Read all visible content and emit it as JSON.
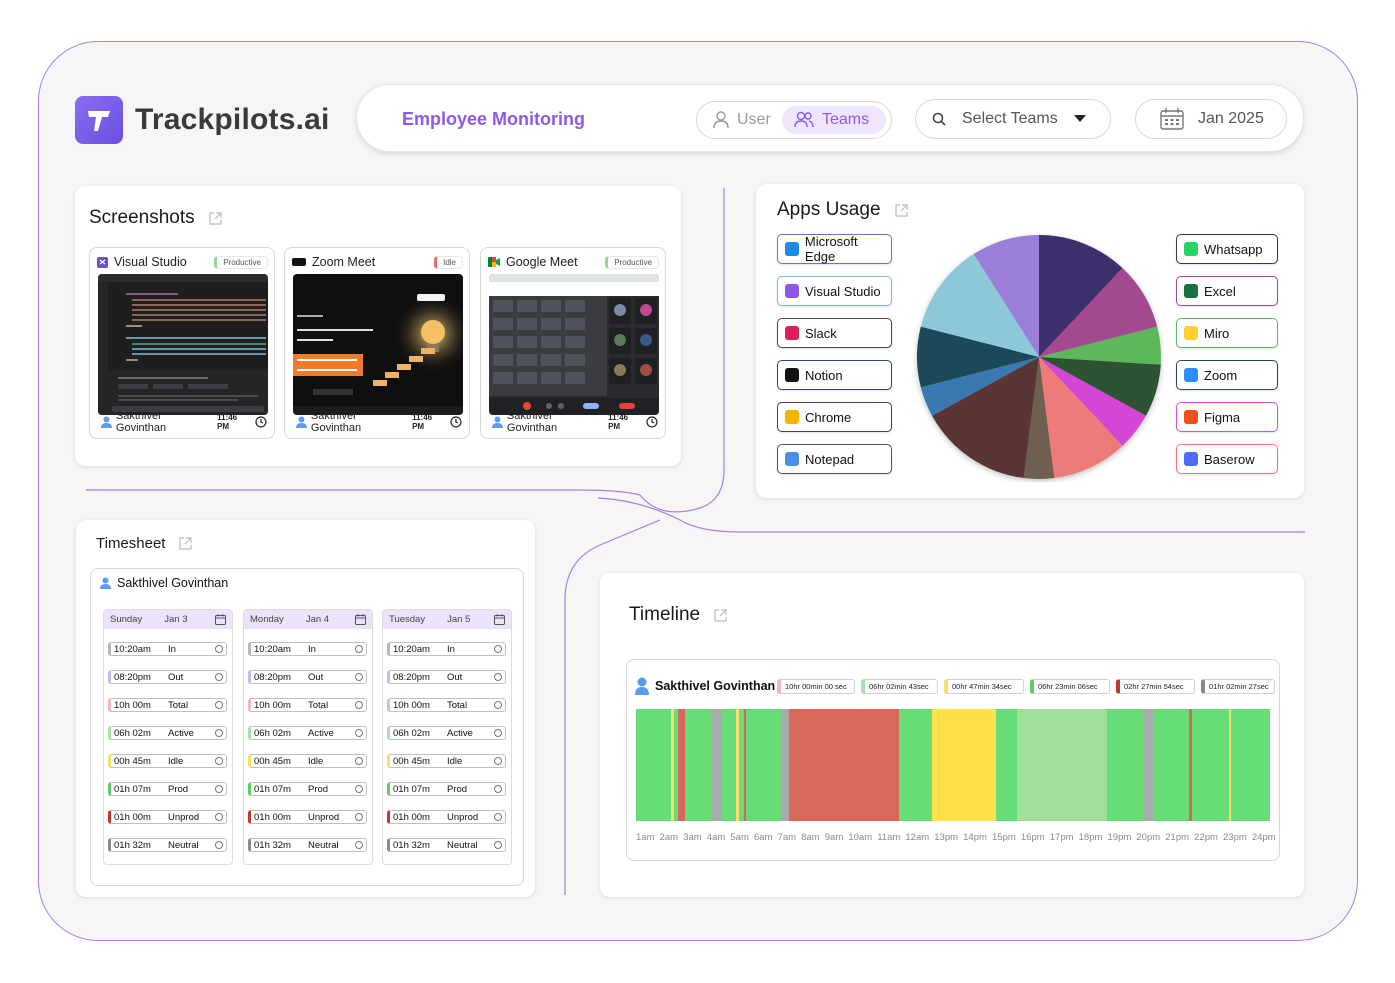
{
  "brand": {
    "name": "Trackpilots.ai"
  },
  "topbar": {
    "title": "Employee Monitoring",
    "toggle": {
      "user": "User",
      "teams": "Teams",
      "active": "Teams"
    },
    "select": {
      "label": "Select Teams"
    },
    "date": {
      "label": "Jan 2025"
    }
  },
  "screenshots": {
    "title": "Screenshots",
    "items": [
      {
        "app": "Visual Studio",
        "status": "Productive",
        "status_color": "#8cd98c",
        "user": "Sakthivel Govinthan",
        "time": "11:46 PM"
      },
      {
        "app": "Zoom Meet",
        "status": "Idle",
        "status_color": "#e96b6b",
        "user": "Sakthivel Govinthan",
        "time": "11:46 PM"
      },
      {
        "app": "Google Meet",
        "status": "Productive",
        "status_color": "#8cd98c",
        "user": "Sakthivel Govinthan",
        "time": "11:46 PM"
      }
    ]
  },
  "apps_usage": {
    "title": "Apps Usage",
    "left_apps": [
      {
        "name": "Microsoft Edge",
        "color": "#1e88e5",
        "border": "#7a6cc6"
      },
      {
        "name": "Visual Studio",
        "color": "#8e58e8",
        "border": "#7fb8d8"
      },
      {
        "name": "Slack",
        "color": "#e01e5a",
        "border": "#4a4a4a"
      },
      {
        "name": "Notion",
        "color": "#111111",
        "border": "#2d4a6e"
      },
      {
        "name": "Chrome",
        "color": "#f4b400",
        "border": "#5c3a3a"
      },
      {
        "name": "Notepad",
        "color": "#4a90e2",
        "border": "#555555"
      }
    ],
    "right_apps": [
      {
        "name": "Whatsapp",
        "color": "#25d366",
        "border": "#3a2e6e"
      },
      {
        "name": "Excel",
        "color": "#1d6f42",
        "border": "#a04b8b"
      },
      {
        "name": "Miro",
        "color": "#ffd02f",
        "border": "#5fb860"
      },
      {
        "name": "Zoom",
        "color": "#2d8cff",
        "border": "#2f4a2f"
      },
      {
        "name": "Figma",
        "color": "#f24e1e",
        "border": "#d94fd8"
      },
      {
        "name": "Baserow",
        "color": "#4a6cf7",
        "border": "#ee7a7a"
      }
    ]
  },
  "chart_data": {
    "type": "pie",
    "slices": [
      {
        "value": 12,
        "color": "#3d2d6e"
      },
      {
        "value": 9,
        "color": "#a34a90"
      },
      {
        "value": 5,
        "color": "#5db85c"
      },
      {
        "value": 7,
        "color": "#2f5232"
      },
      {
        "value": 5,
        "color": "#d447d4"
      },
      {
        "value": 10,
        "color": "#ee7a7a"
      },
      {
        "value": 4,
        "color": "#6e5e50"
      },
      {
        "value": 15,
        "color": "#5a3434"
      },
      {
        "value": 4,
        "color": "#3a77b0"
      },
      {
        "value": 8,
        "color": "#1f4a5a"
      },
      {
        "value": 12,
        "color": "#8cc8d8"
      },
      {
        "value": 9,
        "color": "#9b7ed8"
      }
    ]
  },
  "timesheet": {
    "title": "Timesheet",
    "user": "Sakthivel Govinthan",
    "days": [
      {
        "day": "Sunday",
        "date": "Jan 3"
      },
      {
        "day": "Monday",
        "date": "Jan 4"
      },
      {
        "day": "Tuesday",
        "date": "Jan 5"
      }
    ],
    "rows": [
      {
        "value": "10:20am",
        "label": "In",
        "color": "#b8b8b8"
      },
      {
        "value": "08:20pm",
        "label": "Out",
        "color": "#c9b8f0"
      },
      {
        "value": "10h 00m",
        "label": "Total",
        "color": "#f0b8b8"
      },
      {
        "value": "06h 02m",
        "label": "Active",
        "color": "#a8e0a8"
      },
      {
        "value": "00h 45m",
        "label": "Idle",
        "color": "#f5e06a"
      },
      {
        "value": "01h 07m",
        "label": "Prod",
        "color": "#63c963"
      },
      {
        "value": "01h 00m",
        "label": "Unprod",
        "color": "#c0392b"
      },
      {
        "value": "01h 32m",
        "label": "Neutral",
        "color": "#8a8a8a"
      }
    ]
  },
  "timeline": {
    "title": "Timeline",
    "user": "Sakthivel Govinthan",
    "legend": [
      {
        "text": "10hr 00min 00 sec",
        "color": "#f0b8b8"
      },
      {
        "text": "06hr 02min 43sec",
        "color": "#a8e0a8"
      },
      {
        "text": "00hr 47min 34sec",
        "color": "#f5e06a"
      },
      {
        "text": "06hr 23min 06sec",
        "color": "#63c963"
      },
      {
        "text": "02hr 27min 54sec",
        "color": "#c0392b"
      },
      {
        "text": "01hr 02min 27sec",
        "color": "#8a8a8a"
      }
    ],
    "hours": [
      "1am",
      "2am",
      "3am",
      "4am",
      "5am",
      "6am",
      "7am",
      "8am",
      "9am",
      "10am",
      "11am",
      "12am",
      "13pm",
      "14pm",
      "15pm",
      "16pm",
      "17pm",
      "18pm",
      "19pm",
      "20pm",
      "21pm",
      "22pm",
      "23pm",
      "24pm"
    ],
    "segments": [
      {
        "start": 0,
        "end": 0.055,
        "color": "#66dd77"
      },
      {
        "start": 0.055,
        "end": 0.06,
        "color": "#f5e06a"
      },
      {
        "start": 0.06,
        "end": 0.067,
        "color": "#66dd77"
      },
      {
        "start": 0.067,
        "end": 0.078,
        "color": "#d9685a"
      },
      {
        "start": 0.078,
        "end": 0.118,
        "color": "#66dd77"
      },
      {
        "start": 0.118,
        "end": 0.135,
        "color": "#aaaaaa"
      },
      {
        "start": 0.135,
        "end": 0.158,
        "color": "#66dd77"
      },
      {
        "start": 0.158,
        "end": 0.163,
        "color": "#f5e06a"
      },
      {
        "start": 0.163,
        "end": 0.17,
        "color": "#66dd77"
      },
      {
        "start": 0.17,
        "end": 0.173,
        "color": "#d9685a"
      },
      {
        "start": 0.173,
        "end": 0.228,
        "color": "#66dd77"
      },
      {
        "start": 0.228,
        "end": 0.242,
        "color": "#aaaaaa"
      },
      {
        "start": 0.242,
        "end": 0.415,
        "color": "#d9685a"
      },
      {
        "start": 0.415,
        "end": 0.467,
        "color": "#66dd77"
      },
      {
        "start": 0.467,
        "end": 0.568,
        "color": "#ffe04a"
      },
      {
        "start": 0.568,
        "end": 0.601,
        "color": "#66dd77"
      },
      {
        "start": 0.601,
        "end": 0.743,
        "color": "#a0e09a"
      },
      {
        "start": 0.743,
        "end": 0.8,
        "color": "#66dd77"
      },
      {
        "start": 0.8,
        "end": 0.815,
        "color": "#aaaaaa"
      },
      {
        "start": 0.815,
        "end": 0.873,
        "color": "#66dd77"
      },
      {
        "start": 0.873,
        "end": 0.877,
        "color": "#d9685a"
      },
      {
        "start": 0.877,
        "end": 0.935,
        "color": "#66dd77"
      },
      {
        "start": 0.935,
        "end": 0.939,
        "color": "#f5e06a"
      },
      {
        "start": 0.939,
        "end": 1,
        "color": "#66dd77"
      }
    ]
  }
}
